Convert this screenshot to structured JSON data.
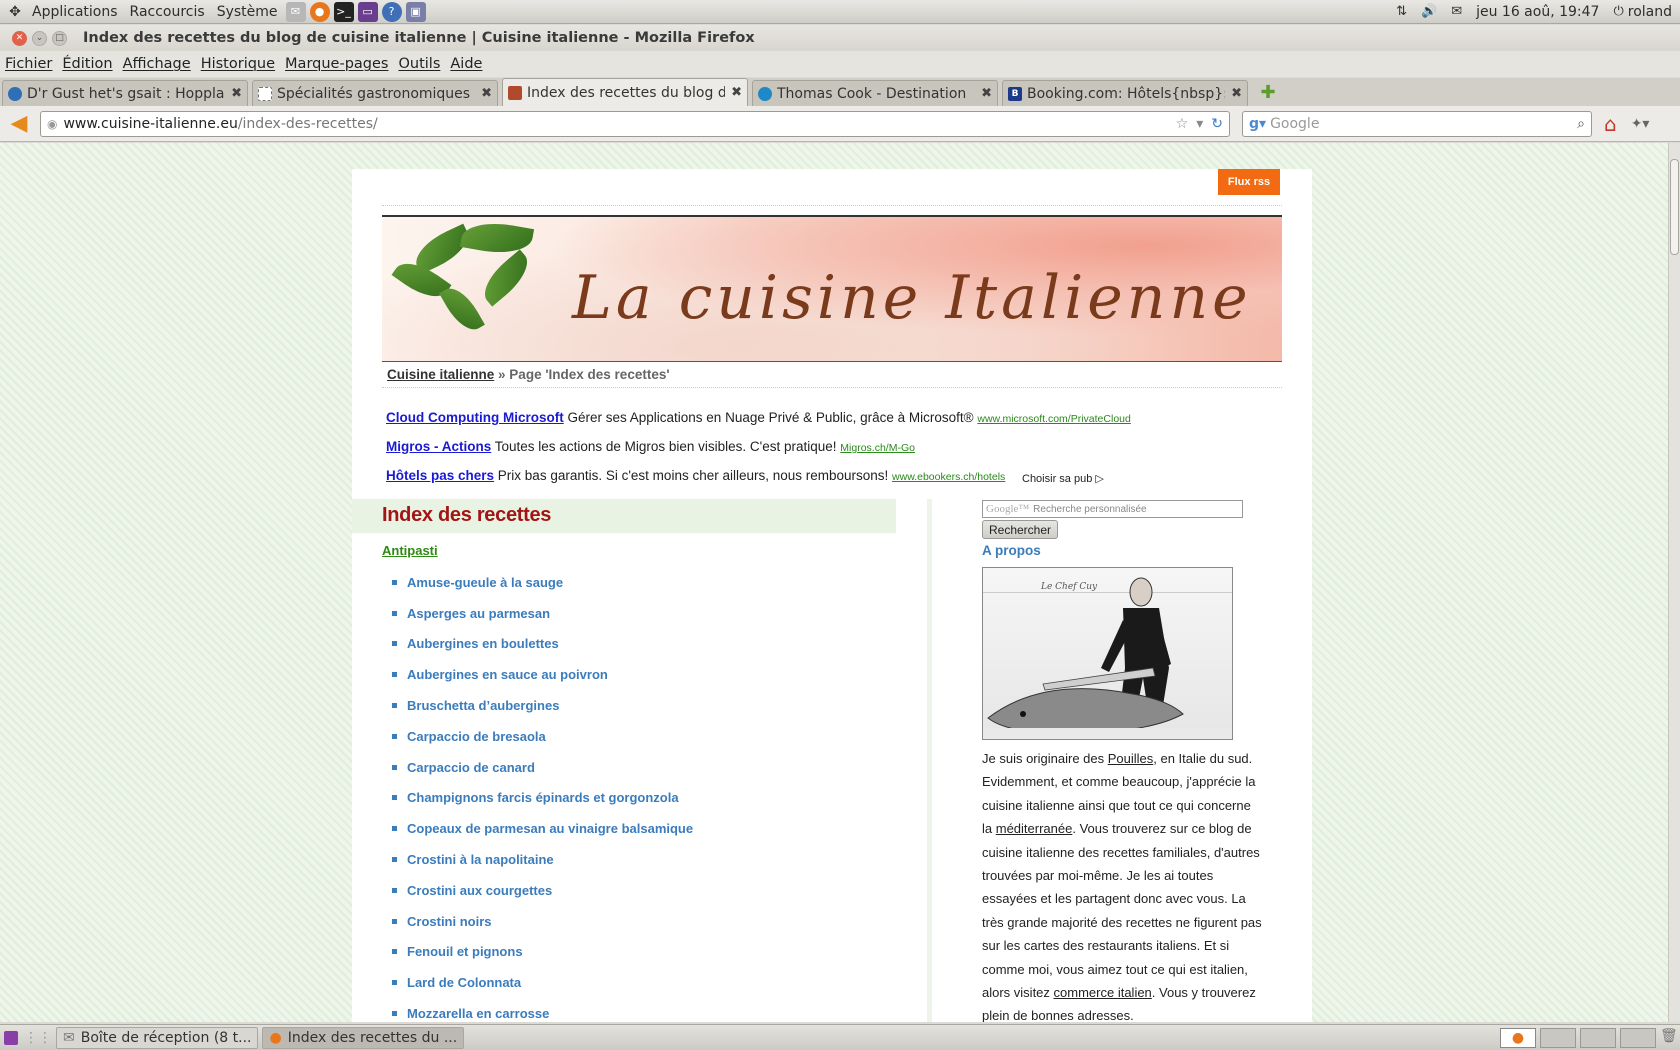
{
  "panel": {
    "menus": [
      "Applications",
      "Raccourcis",
      "Système"
    ],
    "clock": "jeu 16 aoû, 19:47",
    "user": "roland"
  },
  "window": {
    "title": "Index des recettes du blog de cuisine italienne | Cuisine italienne - Mozilla Firefox"
  },
  "menubar": [
    "Fichier",
    "Édition",
    "Affichage",
    "Historique",
    "Marque-pages",
    "Outils",
    "Aide"
  ],
  "tabs": [
    {
      "label": "D'r Gust het's gsait : Hoppla....",
      "favicon_color": "#2f6fb8"
    },
    {
      "label": "Spécialités gastronomiques ...",
      "favicon_color": "#ffffff"
    },
    {
      "label": "Index des recettes du blog d...",
      "favicon_color": "#b04a2a"
    },
    {
      "label": "Thomas Cook - Destination",
      "favicon_color": "#1e88c8"
    },
    {
      "label": "Booking.com: Hôtels{nbsp}:...",
      "favicon_color": "#1b3a8a"
    }
  ],
  "navbar": {
    "url_host": "www.cuisine-italienne.eu",
    "url_path": "/index-des-recettes/",
    "search_placeholder": "Google"
  },
  "page": {
    "rss_label": "Flux rss",
    "banner_title": "La cuisine Italienne",
    "breadcrumb_home": "Cuisine italienne",
    "breadcrumb_current": "» Page 'Index des recettes'",
    "ads": [
      {
        "title": "Cloud Computing Microsoft",
        "text": " Gérer ses Applications en Nuage Privé & Public, grâce à Microsoft® ",
        "url": "www.microsoft.com/PrivateCloud"
      },
      {
        "title": "Migros - Actions",
        "text": " Toutes les actions de Migros bien visibles. C'est pratique! ",
        "url": "Migros.ch/M-Go"
      },
      {
        "title": "Hôtels pas chers",
        "text": " Prix bas garantis. Si c'est moins cher ailleurs, nous remboursons! ",
        "url": "www.ebookers.ch/hotels"
      }
    ],
    "ad_choice": "Choisir sa pub",
    "main_title": "Index des recettes",
    "category": "Antipasti",
    "recipes": [
      "Amuse-gueule à la sauge",
      "Asperges au parmesan",
      "Aubergines en boulettes",
      "Aubergines en sauce au poivron",
      "Bruschetta d’aubergines",
      "Carpaccio de bresaola",
      "Carpaccio de canard",
      "Champignons farcis épinards et gorgonzola",
      "Copeaux de parmesan au vinaigre balsamique",
      "Crostini à la napolitaine",
      "Crostini aux courgettes",
      "Crostini noirs",
      "Fenouil et pignons",
      "Lard de Colonnata",
      "Mozzarella en carrosse"
    ],
    "sidebar": {
      "search_brand": "Google™",
      "search_placeholder": "Recherche personnalisée",
      "search_button": "Rechercher",
      "about_title": "A propos",
      "photo_caption": "Le Chef Cuy",
      "about_text": {
        "p1": "Je suis originaire des ",
        "link1": "Pouilles",
        "p2": ", en Italie du sud. Evidemment, et comme beaucoup, j'apprécie la cuisine italienne ainsi que tout ce qui concerne la ",
        "link2": "méditerranée",
        "p3": ". Vous trouverez sur ce blog de cuisine italienne des recettes familiales, d'autres trouvées par moi-même. Je les ai toutes essayées et les partagent donc avec vous. La très grande majorité des recettes ne figurent pas sur les cartes des restaurants italiens. Et si comme moi, vous aimez tout ce qui est italien, alors visitez ",
        "link3": "commerce italien",
        "p4": ". Vous y trouverez plein de bonnes adresses."
      }
    }
  },
  "taskbar": [
    {
      "label": "Boîte de réception (8 t..."
    },
    {
      "label": "Index des recettes du ..."
    }
  ],
  "colors": {
    "rss": "#f26a12",
    "title_red": "#a31515",
    "link_blue": "#3a7cbc",
    "category_green": "#2d8a12"
  }
}
